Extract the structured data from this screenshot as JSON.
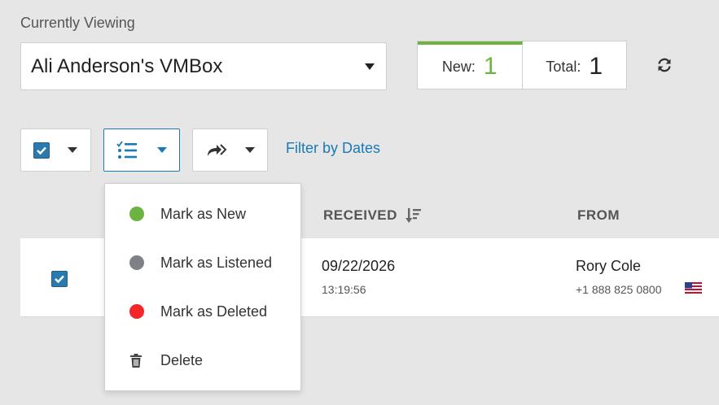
{
  "header": {
    "currently_viewing_label": "Currently Viewing",
    "vmbox_name": "Ali Anderson's VMBox"
  },
  "counts": {
    "new_label": "New:",
    "new_value": "1",
    "total_label": "Total:",
    "total_value": "1"
  },
  "toolbar": {
    "filter_label": "Filter by Dates"
  },
  "columns": {
    "received": "RECEIVED",
    "from": "FROM"
  },
  "rows": [
    {
      "date": "09/22/2026",
      "time": "13:19:56",
      "from_name": "Rory Cole",
      "from_phone": "+1 888 825 0800"
    }
  ],
  "mark_menu": {
    "items": [
      {
        "label": "Mark as New",
        "color": "#6db33f"
      },
      {
        "label": "Mark as Listened",
        "color": "#808088"
      },
      {
        "label": "Mark as Deleted",
        "color": "#f4262a"
      },
      {
        "label": "Delete",
        "icon": "trash-icon"
      }
    ]
  },
  "colors": {
    "accent_blue": "#1a7ab5",
    "new_green": "#6db33f"
  }
}
